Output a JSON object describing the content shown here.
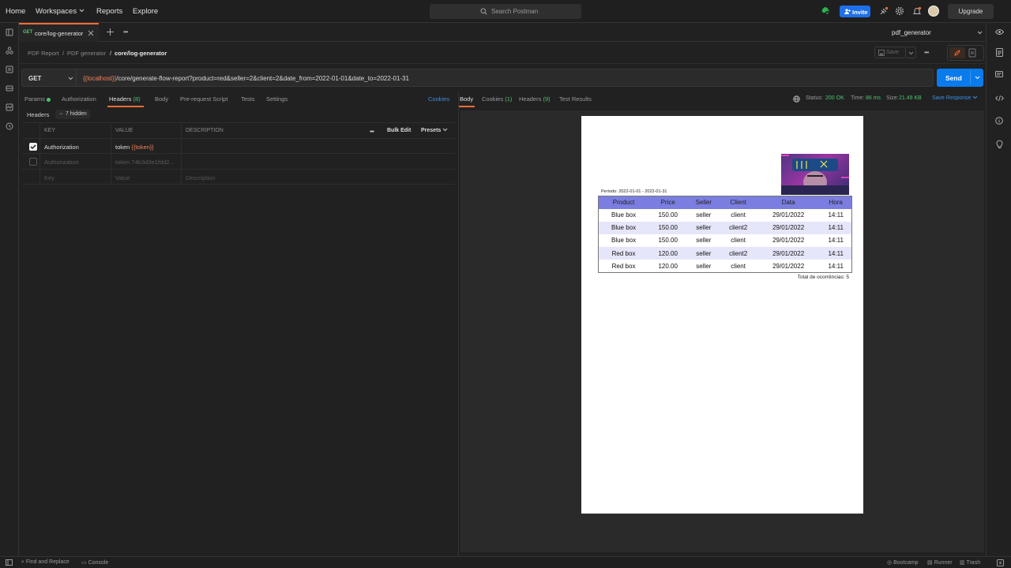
{
  "topbar": {
    "nav": [
      "Home",
      "Workspaces",
      "Reports",
      "Explore"
    ],
    "search_placeholder": "Search Postman",
    "invite": "Invite",
    "upgrade": "Upgrade"
  },
  "tabs": {
    "active_method": "GET",
    "active_title": "core/log-generator",
    "environment": "pdf_generator"
  },
  "breadcrumb": [
    "PDF Report",
    "PDF generator",
    "core/log-generator"
  ],
  "toolbar": {
    "save": "Save"
  },
  "request": {
    "method": "GET",
    "url_var": "{{localhost}}",
    "url_rest": "/core/generate-flow-report?product=red&seller=2&client=2&date_from=2022-01-01&date_to=2022-01-31",
    "send": "Send"
  },
  "request_tabs": {
    "params": "Params",
    "authorization": "Authorization",
    "headers": "Headers",
    "headers_count": "(8)",
    "body": "Body",
    "prerequest": "Pre-request Script",
    "tests": "Tests",
    "settings": "Settings",
    "cookies": "Cookies"
  },
  "headers_section": {
    "label": "Headers",
    "hidden": "7 hidden",
    "col_key": "KEY",
    "col_value": "VALUE",
    "col_desc": "DESCRIPTION",
    "more": "•••",
    "bulk_edit": "Bulk Edit",
    "presets": "Presets",
    "rows": [
      {
        "key": "Authorization",
        "value_prefix": "token ",
        "value_var": "{{token}}",
        "checked": true
      },
      {
        "key": "Authorization",
        "value_prefix": "token 74b3d3e1fdd2...",
        "value_var": "",
        "checked": false
      }
    ],
    "placeholder_key": "Key",
    "placeholder_value": "Value",
    "placeholder_desc": "Description"
  },
  "response_tabs": {
    "body": "Body",
    "cookies": "Cookies",
    "cookies_count": "(1)",
    "headers": "Headers",
    "headers_count": "(9)",
    "test_results": "Test Results",
    "status_label": "Status:",
    "status_value": "200 OK",
    "time_label": "Time:",
    "time_value": "86 ms",
    "size_label": "Size:",
    "size_value": "21.49 KB",
    "save_response": "Save Response"
  },
  "pdf": {
    "period": "Período: 2022-01-01 - 2022-01-31",
    "columns": [
      "Product",
      "Price",
      "Seller",
      "Client",
      "Data",
      "Hora"
    ],
    "rows": [
      [
        "Blue box",
        "150.00",
        "seller",
        "client",
        "29/01/2022",
        "14:11"
      ],
      [
        "Blue box",
        "150.00",
        "seller",
        "client2",
        "29/01/2022",
        "14:11"
      ],
      [
        "Blue box",
        "150.00",
        "seller",
        "client",
        "29/01/2022",
        "14:11"
      ],
      [
        "Red box",
        "120.00",
        "seller",
        "client2",
        "29/01/2022",
        "14:11"
      ],
      [
        "Red box",
        "120.00",
        "seller",
        "client",
        "29/01/2022",
        "14:11"
      ]
    ],
    "total": "Total de ocorrências: 5"
  },
  "statusbar": {
    "find_replace": "Find and Replace",
    "console": "Console",
    "bootcamp": "Bootcamp",
    "runner": "Runner",
    "trash": "Trash"
  },
  "colors": {
    "accent": "#ff6c37",
    "send": "#097bed",
    "status_ok": "#4ec56b",
    "pdf_header": "#7b7ee0",
    "pdf_alt_row": "#e6e6fa"
  },
  "icons": [
    "search-icon",
    "sync-icon",
    "user-plus-icon",
    "satellite-icon",
    "gear-icon",
    "bell-icon",
    "avatar",
    "plus-icon",
    "more-icon",
    "chevron-down-icon",
    "pencil-icon",
    "globe-icon",
    "eye-icon",
    "document-icon",
    "comment-icon",
    "code-icon",
    "info-icon",
    "lightbulb-icon"
  ]
}
